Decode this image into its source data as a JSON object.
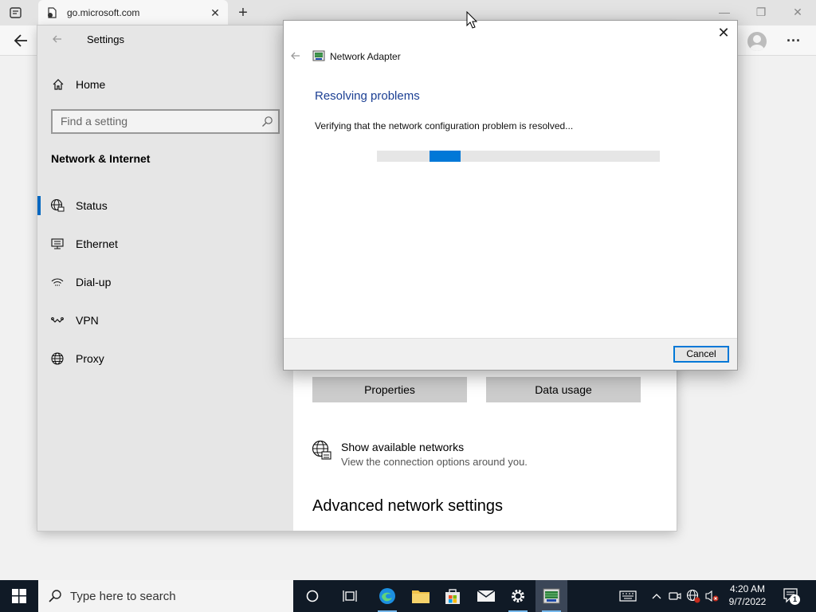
{
  "browser": {
    "tab_title": "go.microsoft.com",
    "tab_close": "✕",
    "new_tab": "+",
    "window_controls": {
      "minimize": "—",
      "restore": "❐",
      "close": "✕"
    },
    "more_label": "···"
  },
  "settings": {
    "title": "Settings",
    "home_label": "Home",
    "search_placeholder": "Find a setting",
    "section_title": "Network & Internet",
    "nav_items": [
      {
        "label": "Status",
        "icon": "globe-status-icon",
        "active": true
      },
      {
        "label": "Ethernet",
        "icon": "ethernet-icon",
        "active": false
      },
      {
        "label": "Dial-up",
        "icon": "dialup-icon",
        "active": false
      },
      {
        "label": "VPN",
        "icon": "vpn-icon",
        "active": false
      },
      {
        "label": "Proxy",
        "icon": "globe-icon",
        "active": false
      }
    ],
    "main": {
      "properties_label": "Properties",
      "data_usage_label": "Data usage",
      "show_networks_title": "Show available networks",
      "show_networks_subtitle": "View the connection options around you.",
      "advanced_title": "Advanced network settings"
    }
  },
  "dialog": {
    "app_title": "Network Adapter",
    "close_label": "✕",
    "heading": "Resolving problems",
    "status": "Verifying that the network configuration problem is resolved...",
    "progress": {
      "indeterminate": true,
      "segment_start_fraction": 0.186,
      "segment_width_fraction": 0.11
    },
    "cancel_label": "Cancel"
  },
  "taskbar": {
    "search_placeholder": "Type here to search",
    "apps": [
      "task-view",
      "edge",
      "file-explorer",
      "store",
      "mail",
      "settings",
      "troubleshooter"
    ],
    "clock_time": "4:20 AM",
    "clock_date": "9/7/2022",
    "notification_count": "1"
  },
  "colors": {
    "accent": "#0078d7",
    "heading_blue": "#1b3f93",
    "taskbar_bg": "#101a26",
    "sidebar_bg": "#e6e6e6"
  }
}
